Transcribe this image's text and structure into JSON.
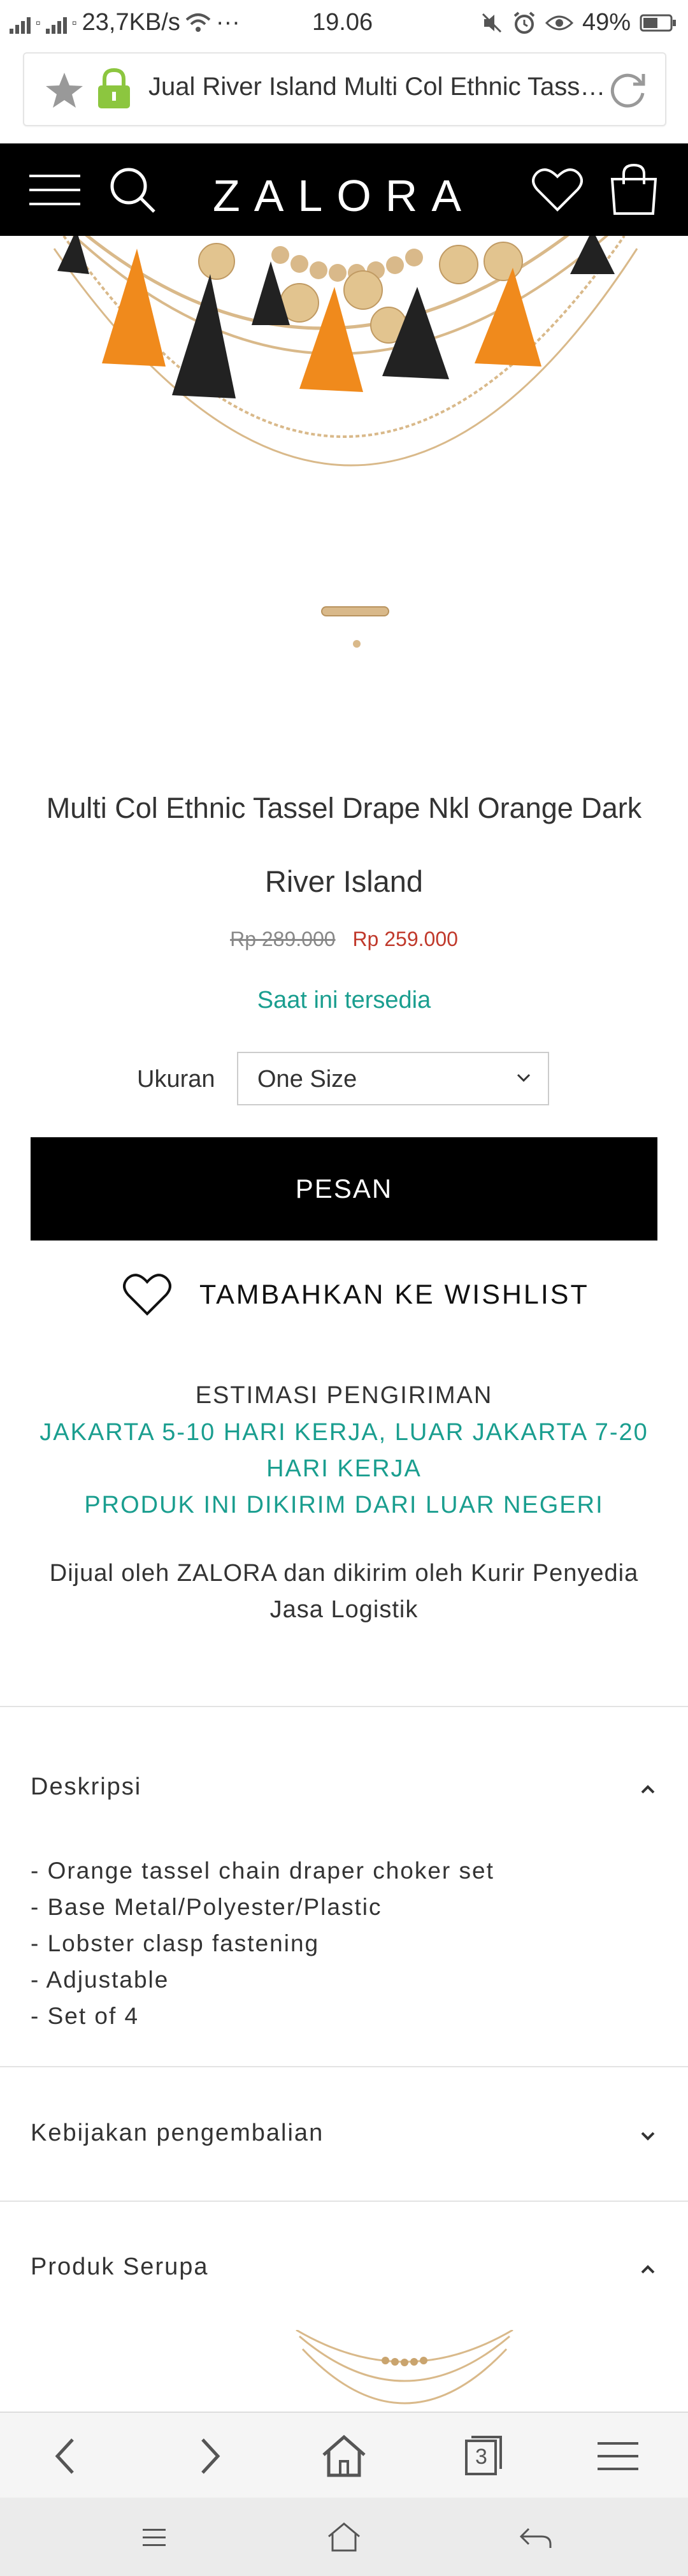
{
  "status_bar": {
    "network_speed": "23,7KB/s",
    "more": "···",
    "time": "19.06",
    "battery": "49%"
  },
  "browser": {
    "url_title": "Jual River Island Multi Col Ethnic Tasse...",
    "icons": [
      "star-icon",
      "lock-icon",
      "refresh-icon"
    ],
    "tab_count": "3"
  },
  "site": {
    "logo": "ZALORA",
    "nav_icons": [
      "menu-icon",
      "search-icon",
      "wishlist-heart-icon",
      "shopping-bag-icon"
    ]
  },
  "product": {
    "title": "Multi Col Ethnic Tassel Drape Nkl Orange Dark",
    "brand": "River Island",
    "old_price": "Rp 289.000",
    "new_price": "Rp 259.000",
    "availability": "Saat ini tersedia",
    "size_label": "Ukuran",
    "size_value": "One Size",
    "order_button": "PESAN",
    "wishlist_label": "TAMBAHKAN KE WISHLIST"
  },
  "shipping": {
    "title": "ESTIMASI PENGIRIMAN",
    "line1": "JAKARTA 5-10 HARI KERJA, LUAR JAKARTA 7-20",
    "line2": "HARI KERJA",
    "line3": "PRODUK INI DIKIRIM DARI LUAR NEGERI",
    "seller_line1": "Dijual oleh ZALORA dan dikirim oleh Kurir Penyedia",
    "seller_line2": "Jasa Logistik"
  },
  "accordion": {
    "description": {
      "title": "Deskripsi",
      "items": [
        "- Orange tassel chain draper choker set",
        "- Base Metal/Polyester/Plastic",
        "- Lobster clasp fastening",
        "- Adjustable",
        "- Set of 4"
      ]
    },
    "return_policy": {
      "title": "Kebijakan pengembalian"
    },
    "similar": {
      "title": "Produk Serupa"
    }
  },
  "colors": {
    "accent_teal": "#1a9e8f",
    "price_red": "#c0392b",
    "tassel_orange": "#f08a1c",
    "tassel_black": "#222222",
    "gold": "#d9b98a"
  }
}
